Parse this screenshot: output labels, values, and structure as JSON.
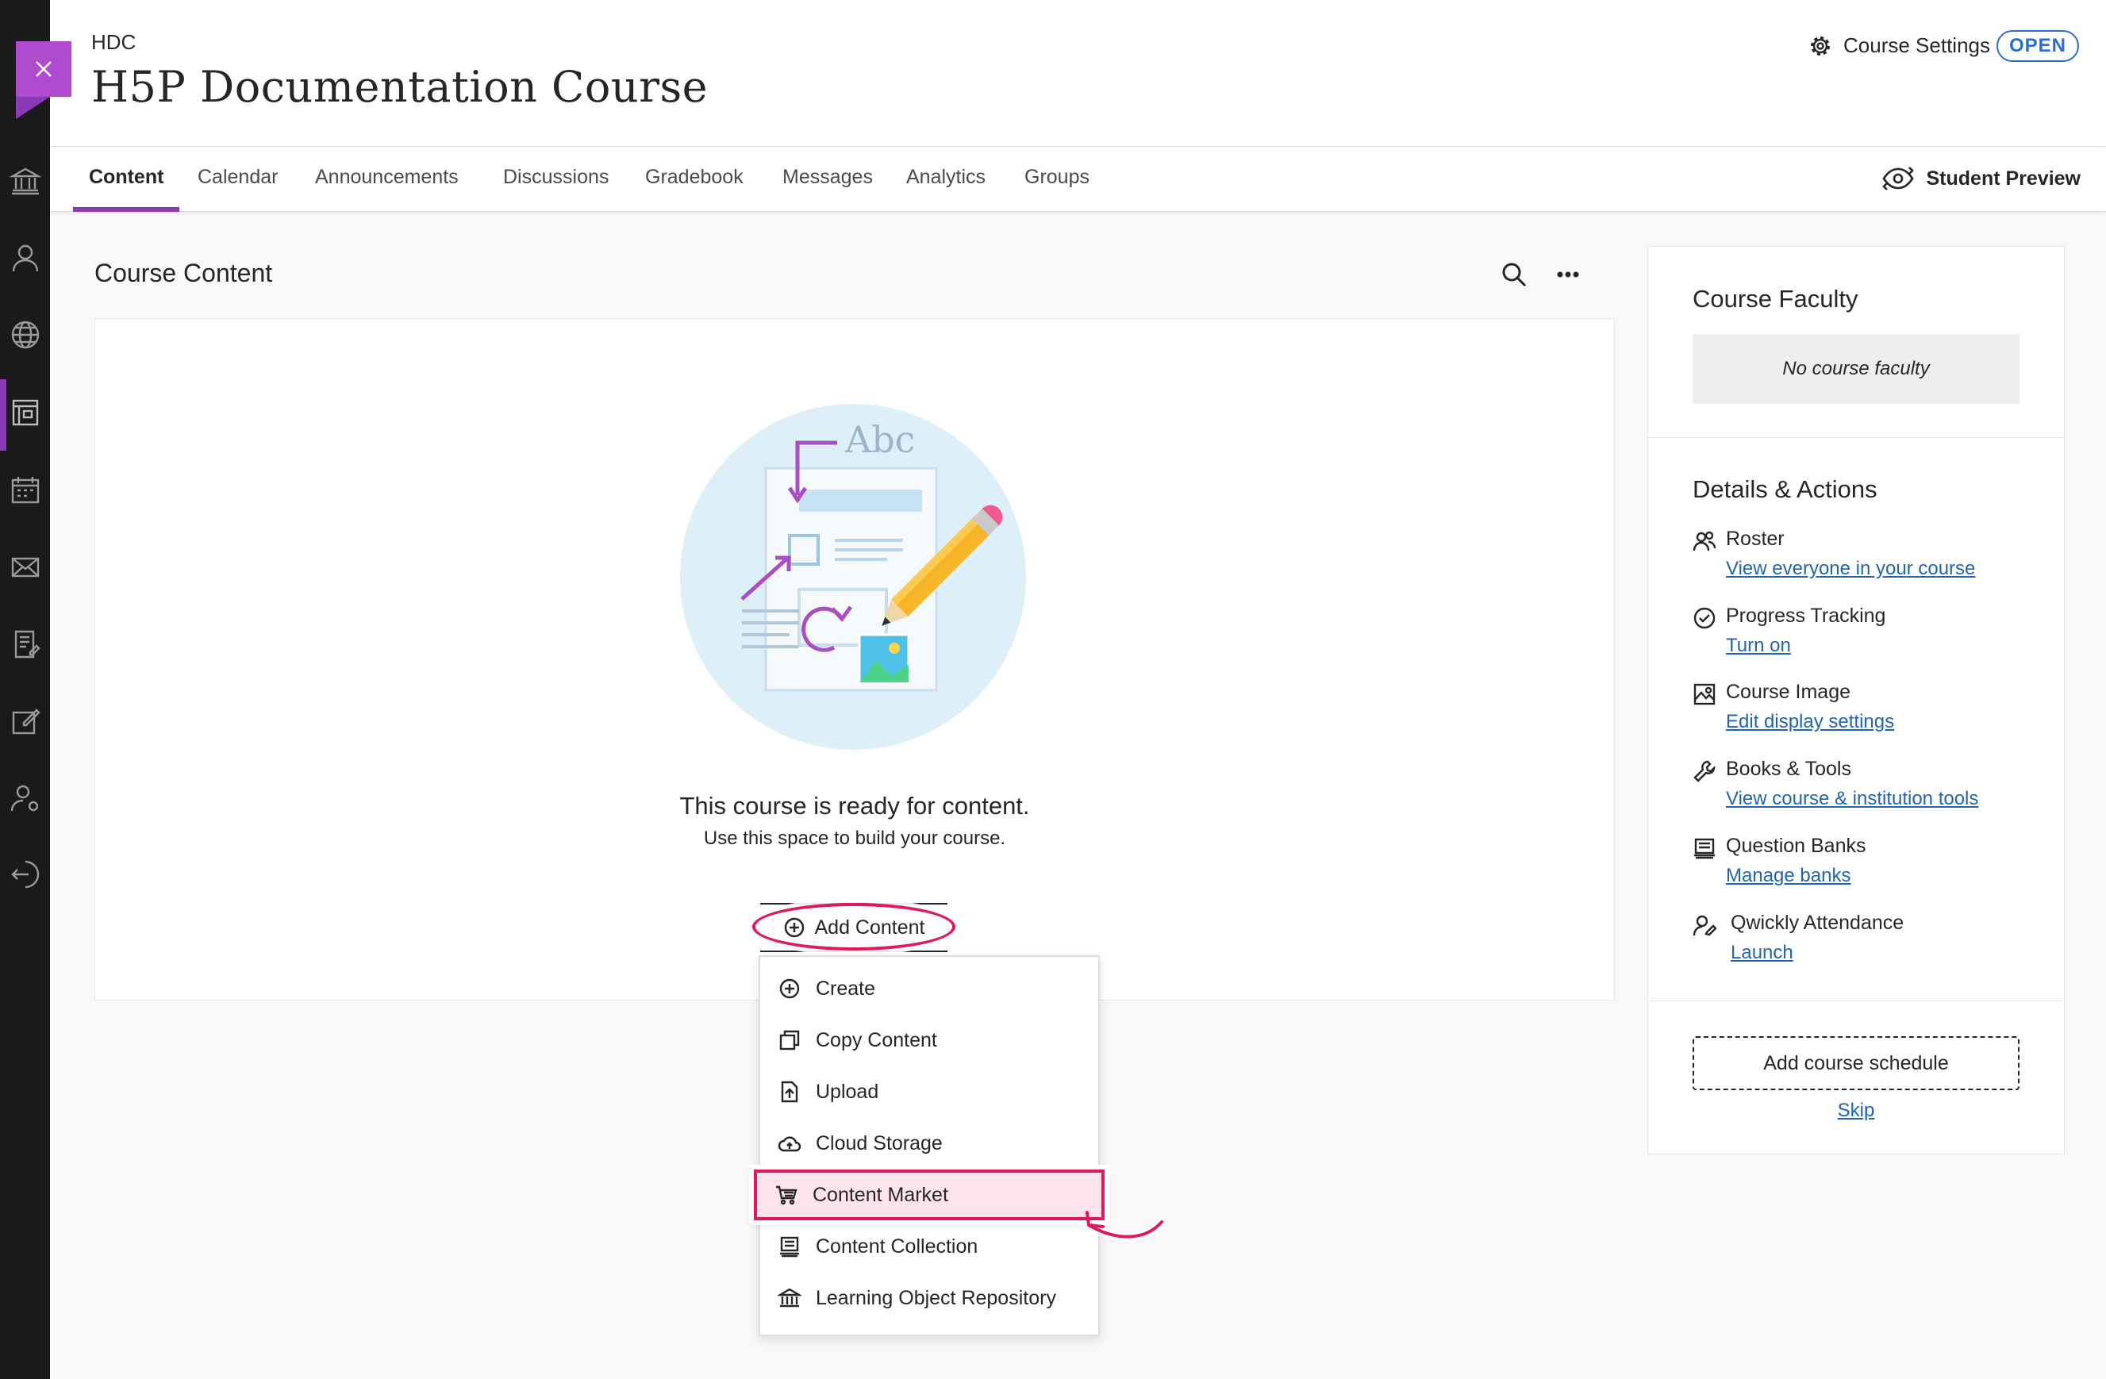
{
  "header": {
    "course_code": "HDC",
    "course_title": "H5P Documentation Course",
    "settings_label": "Course Settings",
    "status_badge": "OPEN"
  },
  "tabs": [
    {
      "label": "Content",
      "active": true
    },
    {
      "label": "Calendar"
    },
    {
      "label": "Announcements"
    },
    {
      "label": "Discussions"
    },
    {
      "label": "Gradebook"
    },
    {
      "label": "Messages"
    },
    {
      "label": "Analytics"
    },
    {
      "label": "Groups"
    }
  ],
  "student_preview_label": "Student Preview",
  "main": {
    "section_title": "Course Content",
    "empty_title": "This course is ready for content.",
    "empty_subtitle": "Use this space to build your course.",
    "illustration_text": "Abc",
    "add_content_label": "Add Content"
  },
  "add_menu": [
    {
      "label": "Create",
      "icon": "plus-circle-icon"
    },
    {
      "label": "Copy Content",
      "icon": "copy-icon"
    },
    {
      "label": "Upload",
      "icon": "upload-icon"
    },
    {
      "label": "Cloud Storage",
      "icon": "cloud-icon"
    },
    {
      "label": "Content Market",
      "icon": "cart-icon",
      "highlighted": true
    },
    {
      "label": "Content Collection",
      "icon": "collection-icon"
    },
    {
      "label": "Learning Object Repository",
      "icon": "repository-icon"
    }
  ],
  "sidebar": {
    "faculty_title": "Course Faculty",
    "faculty_empty": "No course faculty",
    "details_title": "Details & Actions",
    "actions": [
      {
        "label": "Roster",
        "link": "View everyone in your course",
        "icon": "roster-icon"
      },
      {
        "label": "Progress Tracking",
        "link": "Turn on",
        "icon": "check-circle-icon"
      },
      {
        "label": "Course Image",
        "link": "Edit display settings",
        "icon": "image-icon"
      },
      {
        "label": "Books & Tools",
        "link": "View course & institution tools",
        "icon": "wrench-icon"
      },
      {
        "label": "Question Banks",
        "link": "Manage banks",
        "icon": "question-bank-icon"
      },
      {
        "label": "Qwickly Attendance",
        "link": "Launch",
        "icon": "attendance-icon"
      }
    ],
    "schedule_button": "Add course schedule",
    "skip_link": "Skip"
  },
  "colors": {
    "accent_purple": "#8a3ab9",
    "close_purple": "#b04bd0",
    "highlight_red": "#e0195a",
    "link_blue": "#1f64b5",
    "badge_blue": "#2b6cd3"
  }
}
